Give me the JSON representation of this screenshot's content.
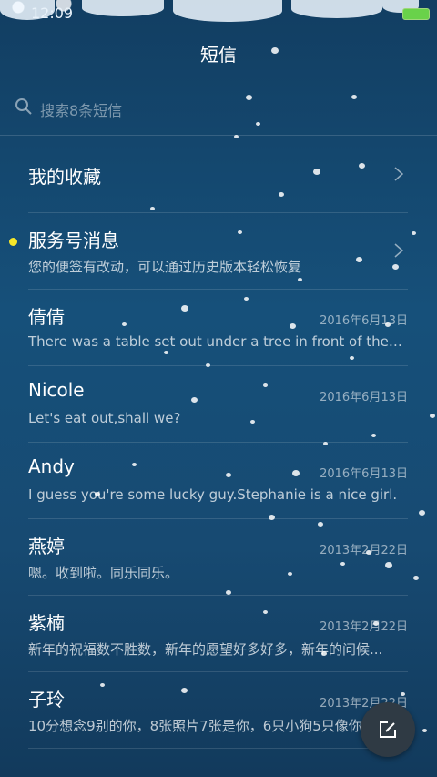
{
  "status": {
    "time": "12:09",
    "battery_color": "#69d24a"
  },
  "header": {
    "title": "短信"
  },
  "search": {
    "placeholder": "搜索8条短信"
  },
  "list": [
    {
      "name": "我的收藏",
      "date": "",
      "preview": "",
      "has_chevron": true,
      "unread": false
    },
    {
      "name": "服务号消息",
      "date": "",
      "preview": "您的便签有改动，可以通过历史版本轻松恢复",
      "has_chevron": true,
      "unread": true
    },
    {
      "name": "倩倩",
      "date": "2016年6月13日",
      "preview": "There was a table set out under a tree in front of the ho...",
      "has_chevron": false,
      "unread": false
    },
    {
      "name": "Nicole",
      "date": "2016年6月13日",
      "preview": "Let's eat out,shall we?",
      "has_chevron": false,
      "unread": false
    },
    {
      "name": "Andy",
      "date": "2016年6月13日",
      "preview": "I guess you're some lucky guy.Stephanie is a nice girl.",
      "has_chevron": false,
      "unread": false
    },
    {
      "name": "燕婷",
      "date": "2013年2月22日",
      "preview": "嗯。收到啦。同乐同乐。",
      "has_chevron": false,
      "unread": false
    },
    {
      "name": "紫楠",
      "date": "2013年2月22日",
      "preview": "新年的祝福数不胜数，新年的愿望好多好多，新年的问候...",
      "has_chevron": false,
      "unread": false
    },
    {
      "name": "子玲",
      "date": "2013年2月22日",
      "preview": "10分想念9别的你，8张照片7张是你，6只小狗5只像你...",
      "has_chevron": false,
      "unread": false
    }
  ],
  "fab": {
    "icon": "compose-icon"
  },
  "colors": {
    "unread_dot": "#f6e72a",
    "background": "#16507a"
  }
}
